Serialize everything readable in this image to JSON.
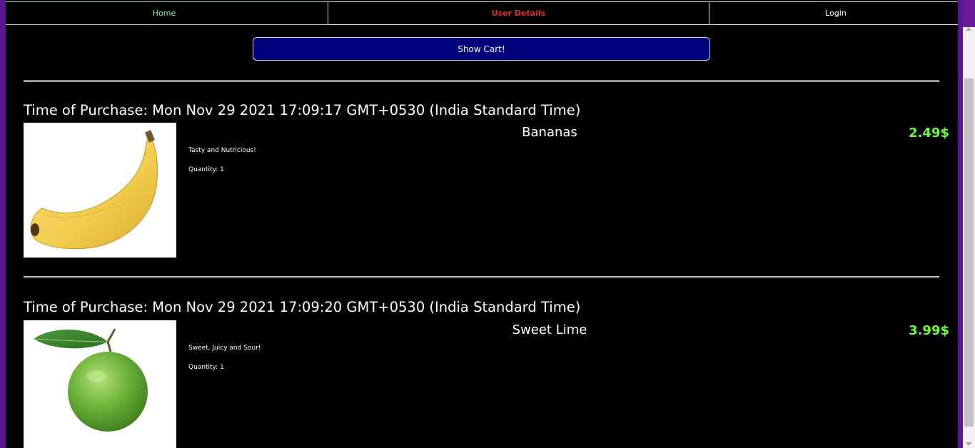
{
  "nav": {
    "home": "Home",
    "user_details": "User Details",
    "login": "Login"
  },
  "show_cart_label": "Show Cart!",
  "purchases": [
    {
      "time_label": "Time of Purchase: Mon Nov 29 2021 17:09:17 GMT+0530 (India Standard Time)",
      "name": "Bananas",
      "description": "Tasty and Nutricious!",
      "quantity": "Quantity: 1",
      "price": "2.49$",
      "image_icon": "banana-image"
    },
    {
      "time_label": "Time of Purchase: Mon Nov 29 2021 17:09:20 GMT+0530 (India Standard Time)",
      "name": "Sweet Lime",
      "description": "Sweet, Juicy and Sour!",
      "quantity": "Quantity: 1",
      "price": "3.99$",
      "image_icon": "lime-image"
    }
  ],
  "colors": {
    "home_accent": "#90ee90",
    "user_details_accent": "#e0302a",
    "price": "#66ff33",
    "show_cart_bg": "#00007a",
    "side_border": "#5d1597"
  }
}
